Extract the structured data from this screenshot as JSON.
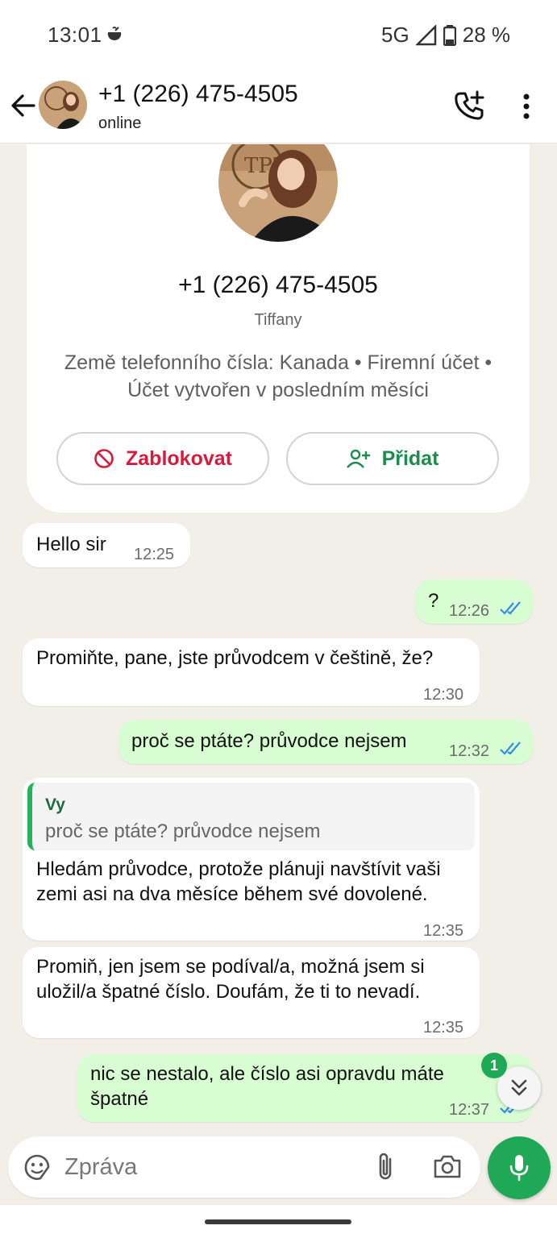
{
  "status_bar": {
    "time": "13:01",
    "network": "5G",
    "battery": "28 %"
  },
  "header": {
    "title": "+1 (226) 475-4505",
    "subtitle": "online"
  },
  "contact_card": {
    "phone": "+1 (226) 475-4505",
    "name": "Tiffany",
    "meta": "Země telefonního čísla: Kanada • Firemní účet • Účet vytvořen v posledním měsíci",
    "block_label": "Zablokovat",
    "add_label": "Přidat"
  },
  "messages": [
    {
      "dir": "in",
      "text": "Hello sir",
      "time": "12:25"
    },
    {
      "dir": "out",
      "text": "?",
      "time": "12:26",
      "status": "read"
    },
    {
      "dir": "in",
      "text": "Promiňte, pane, jste průvodcem v češtině, že?",
      "time": "12:30"
    },
    {
      "dir": "out",
      "text": "proč se ptáte? průvodce nejsem",
      "time": "12:32",
      "status": "read"
    },
    {
      "dir": "in",
      "quote": {
        "author": "Vy",
        "text": "proč se ptáte? průvodce nejsem"
      },
      "text": "Hledám průvodce, protože plánuji navštívit vaši zemi asi na dva měsíce během své dovolené.",
      "time": "12:35"
    },
    {
      "dir": "in",
      "text": "Promiň, jen jsem se podíval/a, možná jsem si uložil/a špatné číslo. Doufám, že ti to nevadí.",
      "time": "12:35"
    },
    {
      "dir": "out",
      "text": "nic se nestalo, ale číslo asi opravdu máte špatné",
      "time": "12:37",
      "status": "read"
    }
  ],
  "unread_count": "1",
  "composer": {
    "placeholder": "Zpráva"
  },
  "colors": {
    "accent": "#1fa855",
    "outgoing_bubble": "#d9fdd3",
    "block_red": "#d81b3c",
    "read_ticks": "#2e8fe6"
  },
  "icons": [
    "back-arrow-icon",
    "call-add-icon",
    "more-vert-icon",
    "block-icon",
    "add-person-icon",
    "double-chevron-down-icon",
    "emoji-icon",
    "attach-icon",
    "camera-icon",
    "mic-icon"
  ]
}
